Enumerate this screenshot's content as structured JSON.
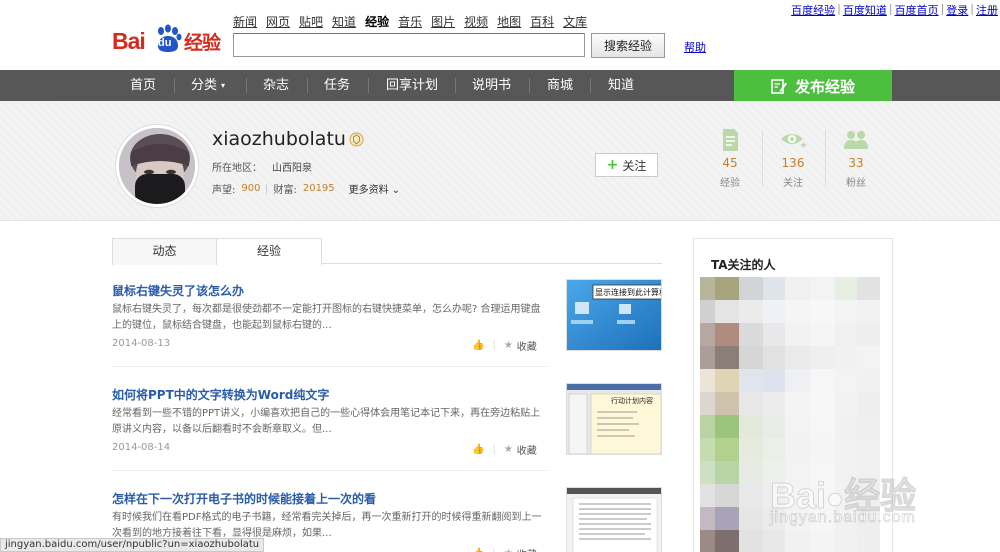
{
  "brand": {
    "logo_bai": "Bai",
    "logo_du": "du",
    "logo_jy": "经验"
  },
  "top_links": [
    "百度经验",
    "百度知道",
    "百度首页",
    "登录",
    "注册"
  ],
  "category_nav": [
    "新闻",
    "网页",
    "贴吧",
    "知道",
    "经验",
    "音乐",
    "图片",
    "视频",
    "地图",
    "百科",
    "文库"
  ],
  "search": {
    "value": "",
    "button_label": "搜索经验",
    "help_label": "帮助"
  },
  "main_nav": [
    "首页",
    "分类",
    "杂志",
    "任务",
    "回享计划",
    "说明书",
    "商城",
    "知道"
  ],
  "publish_label": "发布经验",
  "profile": {
    "username": "xiaozhubolatu",
    "region_label": "所在地区：",
    "region": "山西阳泉",
    "reputation_label": "声望:",
    "reputation": "900",
    "wealth_label": "财富:",
    "wealth": "20195",
    "more_label": "更多资料",
    "follow_label": "关注"
  },
  "stats": [
    {
      "num": "45",
      "label": "经验",
      "icon": "document-icon"
    },
    {
      "num": "136",
      "label": "关注",
      "icon": "eye-icon"
    },
    {
      "num": "33",
      "label": "粉丝",
      "icon": "people-icon"
    }
  ],
  "tabs": [
    "动态",
    "经验"
  ],
  "articles": [
    {
      "title": "鼠标右键失灵了该怎么办",
      "desc": "鼠标右键失灵了，每次都是很使劲都不一定能打开图标的右键快捷菜单，怎么办呢? 合理运用键盘上的键位，鼠标结合键盘，也能起到鼠标右键的...",
      "date": "2014-08-13",
      "fav": "收藏",
      "thumb_text": "显示连接到此计算机"
    },
    {
      "title": "如何将PPT中的文字转换为Word纯文字",
      "desc": "经常看到一些不错的PPT讲义，小编喜欢把自己的一些心得体会用笔记本记下来，再在旁边粘贴上原讲义内容，以备以后翻看时不会断章取义。但...",
      "date": "2014-08-14",
      "fav": "收藏",
      "thumb_text": "行动计划内容"
    },
    {
      "title": "怎样在下一次打开电子书的时候能接着上一次的看",
      "desc": "有时候我们在看PDF格式的电子书籍，经常看完关掉后，再一次重新打开的时候得重新翻阅到上一次看到的地方接着往下看，显得很是麻烦，如果...",
      "date": "",
      "fav": "收藏",
      "thumb_text": ""
    }
  ],
  "sidebar": {
    "title": "TA关注的人"
  },
  "watermark": {
    "brand": "Bai",
    "brand2": "经验",
    "url": "jingyan.baidu.com"
  },
  "status_url": "jingyan.baidu.com/user/npublic?un=xiaozhubolatu",
  "colors": {
    "nav_bg": "#575757",
    "publish_green": "#4cbf3e",
    "link_blue": "#2a5caa",
    "num_orange": "#c57f28",
    "brand_red": "#d52b1e"
  }
}
